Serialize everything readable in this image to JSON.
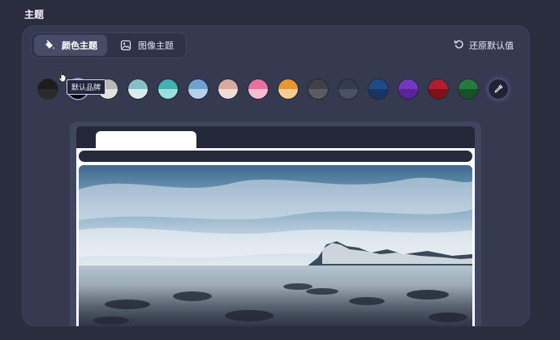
{
  "section": {
    "title": "主题"
  },
  "tabs": [
    {
      "label": "颜色主题",
      "icon": "paint-bucket-icon",
      "active": true
    },
    {
      "label": "图像主题",
      "icon": "image-icon",
      "active": false
    }
  ],
  "reset": {
    "label": "还原默认值",
    "icon": "undo-icon"
  },
  "swatches": [
    {
      "name": "black",
      "top": "#1c1c1c",
      "bottom": "#2b2b2b"
    },
    {
      "name": "default-brand",
      "top": "#2a2f55",
      "bottom": "#000000",
      "selected": true
    },
    {
      "name": "light-gray",
      "top": "#b8b8b8",
      "bottom": "#e2e2e2"
    },
    {
      "name": "pale-teal",
      "top": "#86bfc4",
      "bottom": "#d8ecee"
    },
    {
      "name": "teal",
      "top": "#3fb2b0",
      "bottom": "#9be0dc"
    },
    {
      "name": "sky-blue",
      "top": "#6fa3cf",
      "bottom": "#b5d2ec"
    },
    {
      "name": "peach",
      "top": "#d9a9a0",
      "bottom": "#f2dcd8"
    },
    {
      "name": "pink",
      "top": "#ea6f9d",
      "bottom": "#f7bdd3"
    },
    {
      "name": "orange",
      "top": "#e89630",
      "bottom": "#f5cc93"
    },
    {
      "name": "dark-gray",
      "top": "#3f4048",
      "bottom": "#5a5b63"
    },
    {
      "name": "slate",
      "top": "#343b4c",
      "bottom": "#4a5163"
    },
    {
      "name": "navy",
      "top": "#1f4a8a",
      "bottom": "#163465"
    },
    {
      "name": "purple",
      "top": "#7537c0",
      "bottom": "#5a239c"
    },
    {
      "name": "crimson",
      "top": "#b01e2c",
      "bottom": "#7c1119"
    },
    {
      "name": "green",
      "top": "#287a3a",
      "bottom": "#175226"
    }
  ],
  "picker": {
    "icon": "eyedropper-icon"
  },
  "tooltip": {
    "text": "默认品牌"
  },
  "colors": {
    "background": "#292d3e",
    "panel": "#363a51",
    "accent": "#8d93c9"
  }
}
